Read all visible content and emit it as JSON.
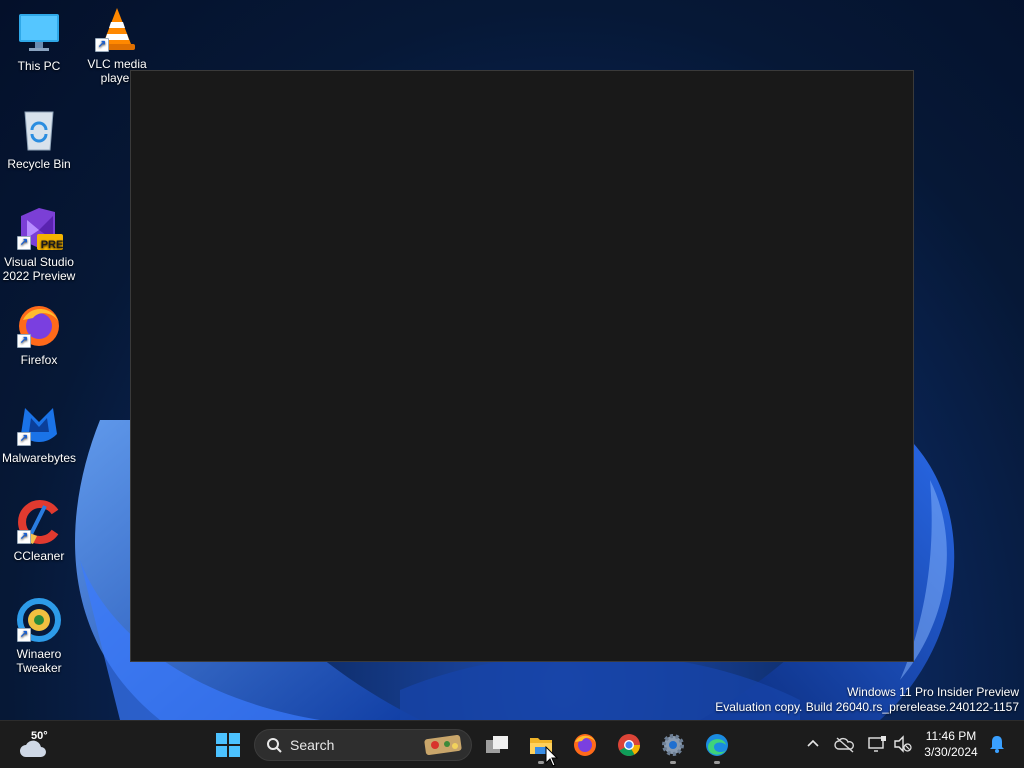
{
  "desktop": {
    "icons": [
      {
        "label": "This PC",
        "icon": "monitor-icon"
      },
      {
        "label": "VLC media player",
        "icon": "vlc-cone-icon"
      },
      {
        "label": "Recycle Bin",
        "icon": "recycle-bin-icon"
      },
      {
        "label": "Visual Studio 2022 Preview",
        "icon": "visual-studio-icon",
        "badge": "PRE"
      },
      {
        "label": "Firefox",
        "icon": "firefox-icon"
      },
      {
        "label": "Malwarebytes",
        "icon": "malwarebytes-icon"
      },
      {
        "label": "CCleaner",
        "icon": "ccleaner-icon"
      },
      {
        "label": "Winaero Tweaker",
        "icon": "winaero-icon"
      }
    ],
    "watermark": {
      "line1": "Windows 11 Pro Insider Preview",
      "line2": "Evaluation copy. Build 26040.rs_prerelease.240122-1157"
    }
  },
  "taskbar": {
    "weather": {
      "temp": "50°",
      "icon": "cloud-icon"
    },
    "search": {
      "label": "Search"
    },
    "apps": [
      {
        "name": "start",
        "icon": "windows-logo-icon"
      },
      {
        "name": "task-view",
        "icon": "task-view-icon"
      },
      {
        "name": "file-explorer",
        "icon": "folder-icon",
        "running": true
      },
      {
        "name": "firefox",
        "icon": "firefox-icon",
        "running": false
      },
      {
        "name": "chrome",
        "icon": "chrome-icon",
        "running": false
      },
      {
        "name": "settings",
        "icon": "gear-icon",
        "running": true
      },
      {
        "name": "edge",
        "icon": "edge-icon",
        "running": true
      }
    ],
    "tray": {
      "time": "11:46 PM",
      "date": "3/30/2024"
    }
  },
  "colors": {
    "taskbar_bg": "#1c1c1c",
    "window_bg": "#191919",
    "accent": "#0078d4"
  }
}
